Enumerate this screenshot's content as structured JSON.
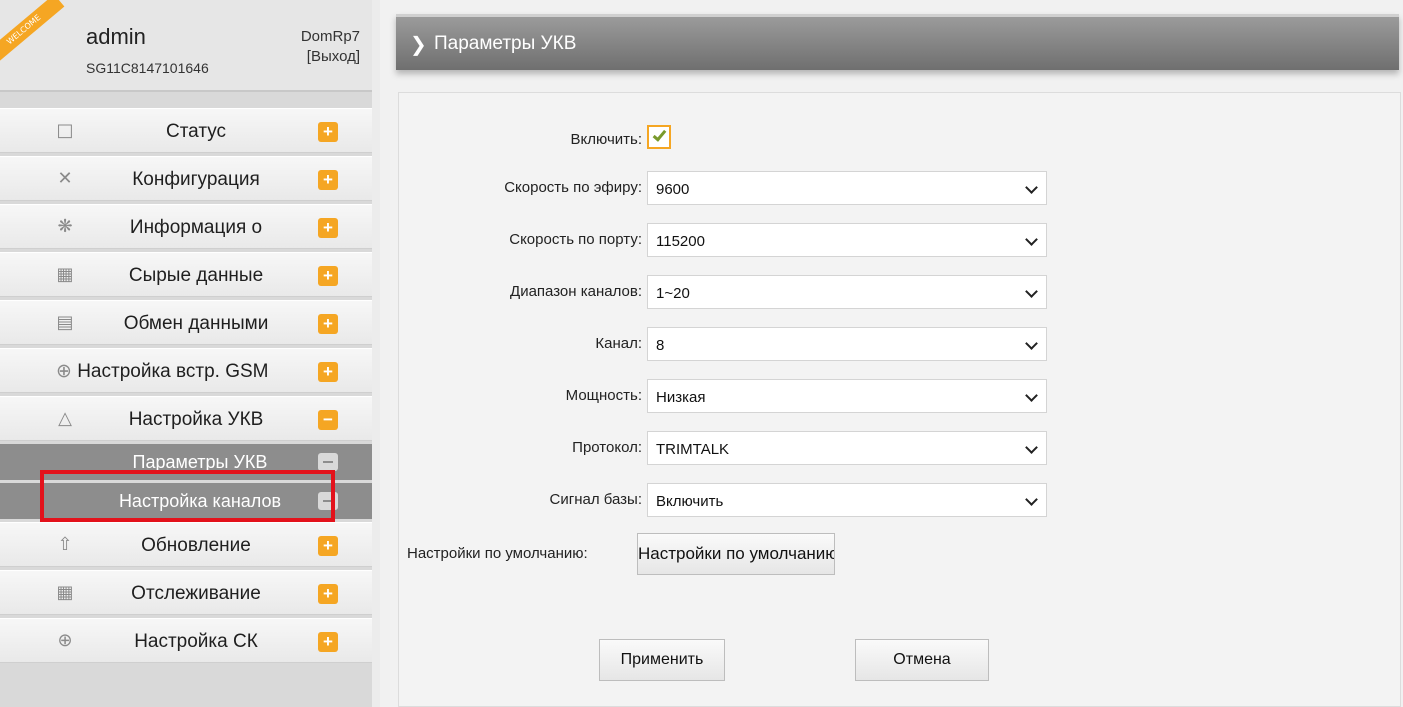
{
  "user": {
    "ribbon": "WELCOME",
    "name": "admin",
    "serial": "SG11C8147101646",
    "device": "DomRp7",
    "logout": "[Выход]"
  },
  "menu": {
    "items": [
      {
        "label": "Статус",
        "icon": "monitor-icon"
      },
      {
        "label": "Конфигурация",
        "icon": "tools-icon"
      },
      {
        "label": "Информация о",
        "icon": "satellite-icon"
      },
      {
        "label": "Сырые данные",
        "icon": "chart-icon"
      },
      {
        "label": "Обмен данными",
        "icon": "network-icon"
      },
      {
        "label": "Настройка встр. GSM",
        "icon": "globe-icon"
      },
      {
        "label": "Настройка УКВ",
        "icon": "antenna-icon"
      }
    ],
    "sub_items": [
      {
        "label": "Параметры УКВ"
      },
      {
        "label": "Настройка каналов"
      }
    ],
    "items_after": [
      {
        "label": "Обновление",
        "icon": "upload-icon"
      },
      {
        "label": "Отслеживание",
        "icon": "calendar-chart-icon"
      },
      {
        "label": "Настройка СК",
        "icon": "globe-icon"
      }
    ]
  },
  "page": {
    "title": "Параметры УКВ"
  },
  "form": {
    "enable_label": "Включить:",
    "enable_checked": true,
    "fields": [
      {
        "label": "Скорость по эфиру:",
        "value": "9600"
      },
      {
        "label": "Скорость по порту:",
        "value": "115200"
      },
      {
        "label": "Диапазон каналов:",
        "value": "1~20"
      },
      {
        "label": "Канал:",
        "value": "8"
      },
      {
        "label": "Мощность:",
        "value": "Низкая"
      },
      {
        "label": "Протокол:",
        "value": "TRIMTALK"
      },
      {
        "label": "Сигнал базы:",
        "value": "Включить"
      }
    ],
    "defaults_label": "Настройки по умолчанию:",
    "defaults_button": "Настройки по умолчанию",
    "apply_button": "Применить",
    "cancel_button": "Отмена"
  },
  "colors": {
    "accent": "#f5a623",
    "highlight": "#e3121b",
    "submenu_bg": "#8d8d8d"
  }
}
